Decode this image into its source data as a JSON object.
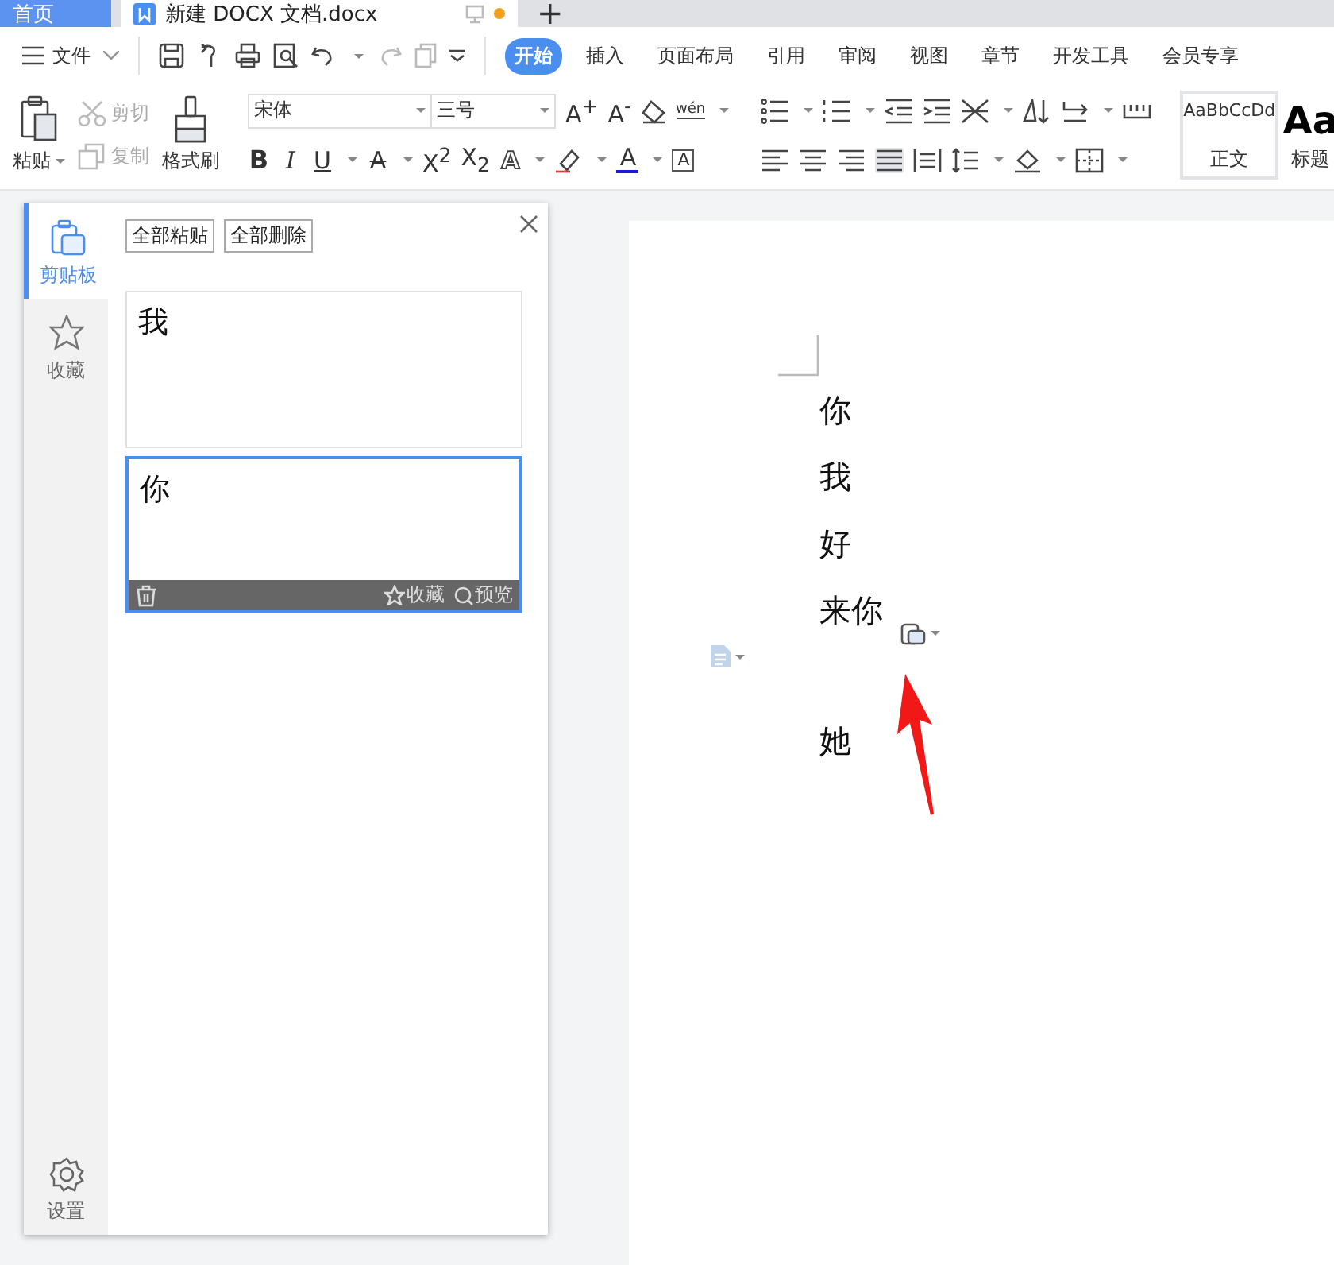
{
  "tab_bar": {
    "tabs": [
      {
        "label": "首页",
        "kind": "home",
        "selected": false
      },
      {
        "label": "新建 DOCX 文档.docx",
        "kind": "doc",
        "selected": true,
        "unsaved": true
      }
    ],
    "new_tab": "+"
  },
  "menu_bar": {
    "file": "文件",
    "tabs": [
      {
        "label": "开始",
        "selected": true
      },
      {
        "label": "插入",
        "selected": false
      },
      {
        "label": "页面布局",
        "selected": false
      },
      {
        "label": "引用",
        "selected": false
      },
      {
        "label": "审阅",
        "selected": false
      },
      {
        "label": "视图",
        "selected": false
      },
      {
        "label": "章节",
        "selected": false
      },
      {
        "label": "开发工具",
        "selected": false
      },
      {
        "label": "会员专享",
        "selected": false
      }
    ]
  },
  "ribbon": {
    "paste": "粘贴",
    "cut": {
      "label": "剪切",
      "disabled": true
    },
    "copy": {
      "label": "复制",
      "disabled": true
    },
    "format_painter": "格式刷",
    "font": "宋体",
    "size": "三号",
    "size_buttons": [
      "A$^{+}$",
      "A$^{-}$"
    ],
    "pinyin": "wén",
    "format_buttons": [
      {
        "text": "B",
        "kind": "bold"
      },
      {
        "text": "I",
        "kind": "italic"
      },
      {
        "text": "U",
        "kind": "underline"
      },
      {
        "text": "A",
        "kind": "strike"
      },
      {
        "text": "X$^{2}$",
        "kind": "plain"
      },
      {
        "text": "X$_{2}$",
        "kind": "plain"
      },
      {
        "text": "A",
        "kind": "outline"
      }
    ],
    "font_color": "A",
    "char_border": "A",
    "styles": [
      {
        "sample": "AaBbCcDd",
        "label": "正文",
        "selected": true
      },
      {
        "sample": "Aa",
        "label": "标题",
        "selected": false
      }
    ]
  },
  "clipboard_panel": {
    "nav": [
      {
        "label": "剪贴板",
        "kind": "clipboard",
        "selected": true
      },
      {
        "label": "收藏",
        "kind": "star",
        "selected": false
      }
    ],
    "settings": "设置",
    "actions": [
      "全部粘贴",
      "全部删除"
    ],
    "items": [
      {
        "text": "我",
        "selected": false
      },
      {
        "text": "你",
        "selected": true
      }
    ],
    "item_toolbar": {
      "favorite": "收藏",
      "preview": "预览"
    }
  },
  "document": {
    "paragraphs_before": [
      "你",
      "我",
      "好",
      "来你"
    ],
    "paragraphs_after": [
      "她"
    ]
  }
}
